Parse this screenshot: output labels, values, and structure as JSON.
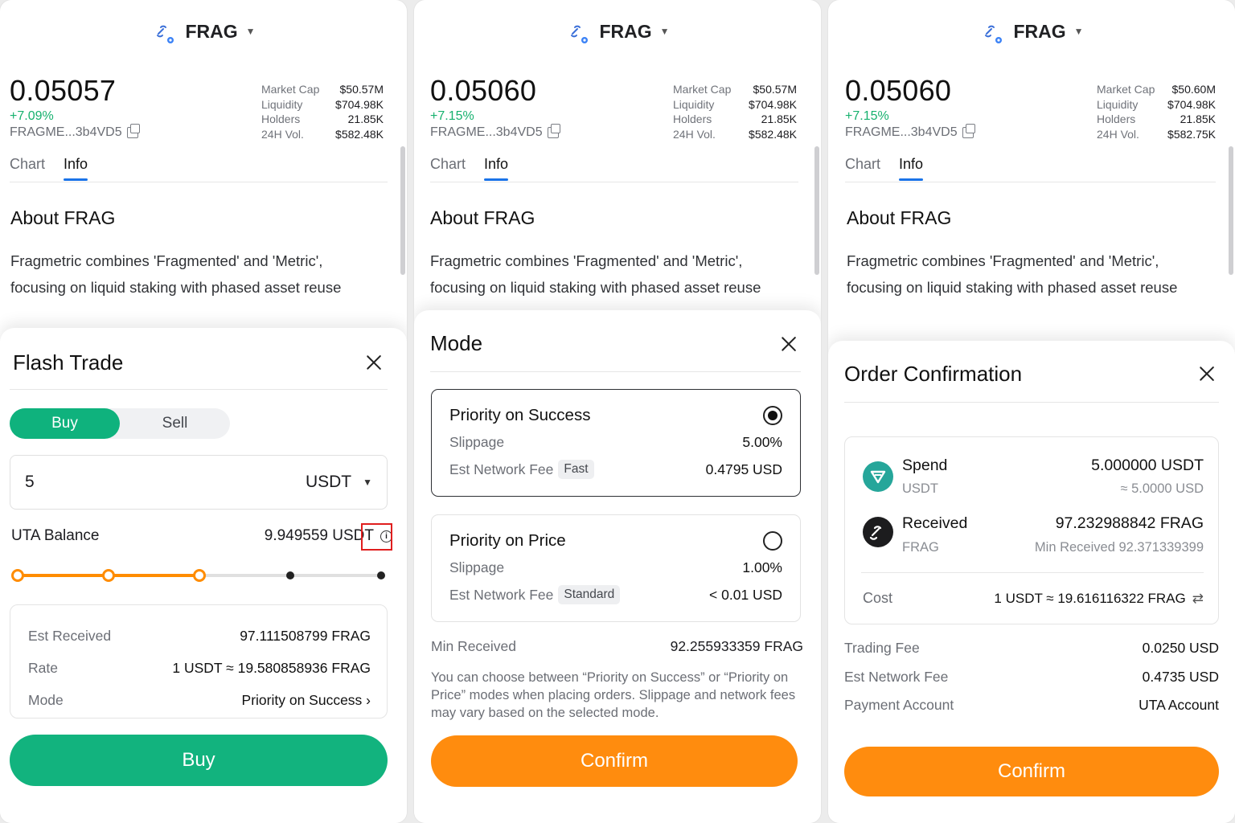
{
  "token": {
    "symbol": "FRAG",
    "address": "FRAGME...3b4VD5"
  },
  "screens": [
    {
      "price": "0.05057",
      "change": "+7.09%",
      "stats": [
        {
          "k": "Market Cap",
          "v": "$50.57M"
        },
        {
          "k": "Liquidity",
          "v": "$704.98K"
        },
        {
          "k": "Holders",
          "v": "21.85K"
        },
        {
          "k": "24H Vol.",
          "v": "$582.48K"
        }
      ]
    },
    {
      "price": "0.05060",
      "change": "+7.15%",
      "stats": [
        {
          "k": "Market Cap",
          "v": "$50.57M"
        },
        {
          "k": "Liquidity",
          "v": "$704.98K"
        },
        {
          "k": "Holders",
          "v": "21.85K"
        },
        {
          "k": "24H Vol.",
          "v": "$582.48K"
        }
      ]
    },
    {
      "price": "0.05060",
      "change": "+7.15%",
      "stats": [
        {
          "k": "Market Cap",
          "v": "$50.60M"
        },
        {
          "k": "Liquidity",
          "v": "$704.98K"
        },
        {
          "k": "Holders",
          "v": "21.85K"
        },
        {
          "k": "24H Vol.",
          "v": "$582.75K"
        }
      ]
    }
  ],
  "tabs": {
    "chart": "Chart",
    "info": "Info",
    "active": "Info"
  },
  "about": {
    "title": "About FRAG",
    "line1": "Fragmetric combines 'Fragmented' and 'Metric',",
    "line2": "focusing on liquid staking with phased asset reuse"
  },
  "flash_trade": {
    "title": "Flash Trade",
    "buy_tab": "Buy",
    "sell_tab": "Sell",
    "active_tab": "Buy",
    "amount": "5",
    "currency": "USDT",
    "balance_label": "UTA Balance",
    "balance_value": "9.949559 USDT",
    "slider": {
      "stops": 5,
      "selected_stop": 3
    },
    "details": [
      {
        "k": "Est Received",
        "v": "97.111508799 FRAG"
      },
      {
        "k": "Rate",
        "v": "1 USDT ≈ 19.580858936 FRAG"
      },
      {
        "k": "Mode",
        "v": "Priority on Success ›"
      }
    ],
    "button": "Buy"
  },
  "mode": {
    "title": "Mode",
    "options": [
      {
        "name": "Priority on Success",
        "selected": true,
        "slippage_label": "Slippage",
        "slippage": "5.00%",
        "fee_label": "Est Network Fee",
        "fee_tag": "Fast",
        "fee": "0.4795 USD"
      },
      {
        "name": "Priority on Price",
        "selected": false,
        "slippage_label": "Slippage",
        "slippage": "1.00%",
        "fee_label": "Est Network Fee",
        "fee_tag": "Standard",
        "fee": "< 0.01 USD"
      }
    ],
    "min_received_label": "Min Received",
    "min_received": "92.255933359 FRAG",
    "note": "You can choose between “Priority on Success” or “Priority on Price” modes when placing orders. Slippage and network fees may vary based on the selected mode.",
    "button": "Confirm"
  },
  "order": {
    "title": "Order Confirmation",
    "spend": {
      "label": "Spend",
      "currency": "USDT",
      "amount": "5.000000 USDT",
      "approx": "≈ 5.0000 USD"
    },
    "received": {
      "label": "Received",
      "currency": "FRAG",
      "amount": "97.232988842 FRAG",
      "min": "Min Received 92.371339399"
    },
    "cost_label": "Cost",
    "cost": "1 USDT ≈ 19.616116322 FRAG",
    "fees": [
      {
        "k": "Trading Fee",
        "v": "0.0250 USD"
      },
      {
        "k": "Est Network Fee",
        "v": "0.4735 USD"
      },
      {
        "k": "Payment Account",
        "v": "UTA Account"
      }
    ],
    "button": "Confirm"
  },
  "icons": {
    "token": "frag-link-icon",
    "copy": "copy-icon",
    "close": "close-icon",
    "info": "info-icon",
    "dropdown": "caret-down-icon",
    "swap": "swap-icon",
    "usdt": "usdt-coin-icon",
    "frag": "frag-coin-icon"
  },
  "colors": {
    "buy_green": "#12b37e",
    "confirm_orange": "#ff8c0e",
    "positive": "#16b16e",
    "tab_underline": "#1a73e8",
    "highlight": "#e01e1e"
  }
}
